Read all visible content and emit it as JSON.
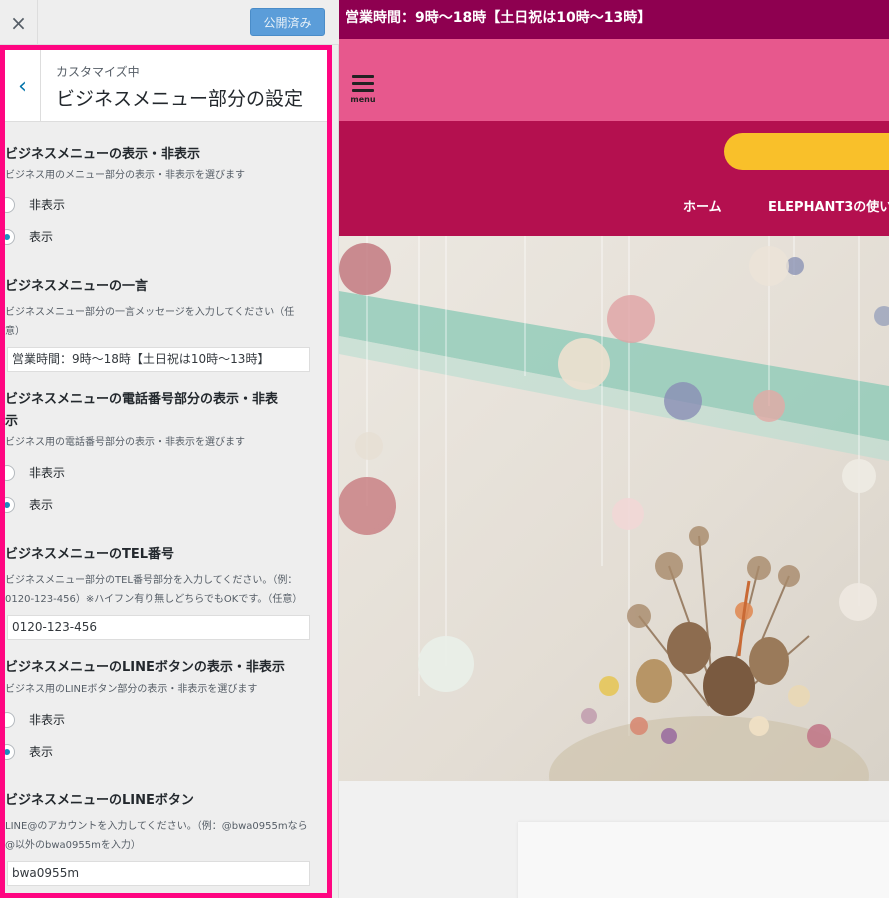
{
  "topbar": {
    "close_icon": "×",
    "publish_label": "公開済み"
  },
  "panel": {
    "back_icon": "‹",
    "breadcrumb": "カスタマイズ中",
    "title": "ビジネスメニュー部分の設定"
  },
  "controls": {
    "menu_visibility": {
      "title": "ビジネスメニューの表示・非表示",
      "description": "ビジネス用のメニュー部分の表示・非表示を選びます",
      "options": [
        "非表示",
        "表示"
      ],
      "selected": "表示"
    },
    "message": {
      "title": "ビジネスメニューの一言",
      "description_line1": "ビジネスメニュー部分の一言メッセージを入力してください（任",
      "description_line2": "意）",
      "value": "営業時間：9時〜18時【土日祝は10時〜13時】"
    },
    "phone_visibility": {
      "title_line1": "ビジネスメニューの電話番号部分の表示・非表",
      "title_line2": "示",
      "description": "ビジネス用の電話番号部分の表示・非表示を選びます",
      "options": [
        "非表示",
        "表示"
      ],
      "selected": "表示"
    },
    "tel": {
      "title": "ビジネスメニューのTEL番号",
      "description_line1": "ビジネスメニュー部分のTEL番号部分を入力してください。（例：",
      "description_line2": "0120-123-456）※ハイフン有り無しどちらでもOKです。（任意）",
      "value": "0120-123-456"
    },
    "line_visibility": {
      "title": "ビジネスメニューのLINEボタンの表示・非表示",
      "description": "ビジネス用のLINEボタン部分の表示・非表示を選びます",
      "options": [
        "非表示",
        "表示"
      ],
      "selected": "表示"
    },
    "line_account": {
      "title": "ビジネスメニューのLINEボタン",
      "description_line1": "LINE@のアカウントを入力してください。（例：@bwa0955mなら",
      "description_line2": "@以外のbwa0955mを入力）",
      "value": "bwa0955m"
    }
  },
  "preview": {
    "business_bar_text": "営業時間：9時〜18時【土日祝は10時〜13時】",
    "hamburger_label": "menu",
    "nav_items": [
      "ホーム",
      "ELEPHANT3の使い"
    ],
    "colors": {
      "business_bar": "#8e0050",
      "header": "#e7588d",
      "nav": "#b4104f",
      "button": "#f9c02a",
      "highlight_border": "#ff0581"
    }
  }
}
